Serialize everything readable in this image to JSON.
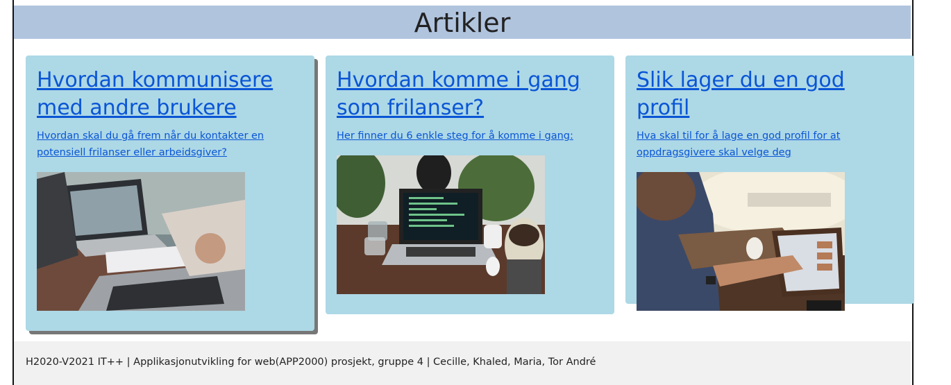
{
  "header": {
    "title": "Artikler"
  },
  "articles": [
    {
      "title": "Hvordan kommunisere med andre brukere",
      "description": "Hvordan skal du gå frem når du kontakter en potensiell frilanser eller arbeidsgiver?",
      "image": "laptops-on-desk-with-notes"
    },
    {
      "title": "Hvordan komme i gang som frilanser?",
      "description": "Her finner du 6 enkle steg for å komme i gang:",
      "image": "laptop-with-code-and-plants"
    },
    {
      "title": "Slik lager du en god profil",
      "description": "Hva skal til for å lage en god profil for at oppdragsgivere skal velge deg",
      "image": "man-using-tablet"
    }
  ],
  "footer": {
    "text": "H2020-V2021 IT++ | Applikasjonutvikling for web(APP2000) prosjekt, gruppe 4 | Cecille, Khaled, Maria, Tor André"
  }
}
